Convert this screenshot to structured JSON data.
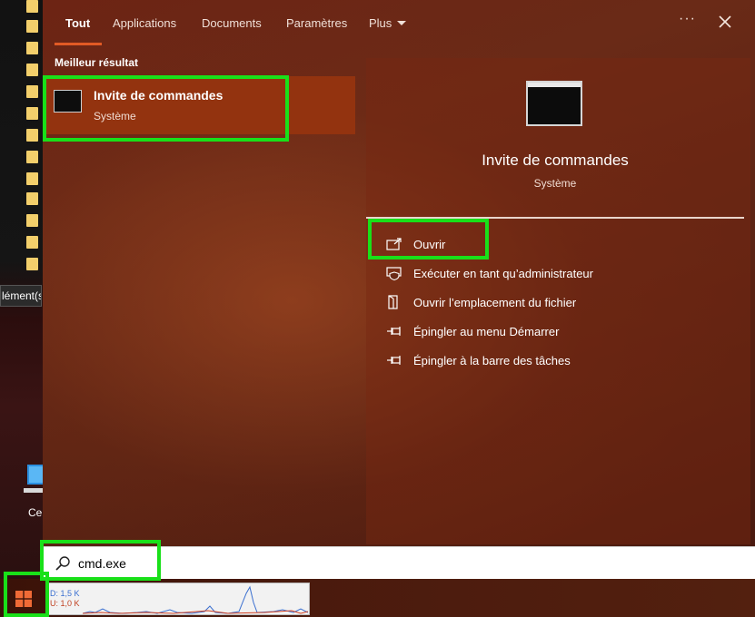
{
  "desktop": {
    "tooltip_fragment": "lément(s)",
    "icon_label_fragment": "Ce"
  },
  "tabs": [
    {
      "label": "Tout",
      "active": true
    },
    {
      "label": "Applications"
    },
    {
      "label": "Documents"
    },
    {
      "label": "Paramètres"
    },
    {
      "label": "Plus"
    }
  ],
  "header": {
    "more_icon": "···"
  },
  "best_match": {
    "heading": "Meilleur résultat",
    "title": "Invite de commandes",
    "subtitle": "Système"
  },
  "detail": {
    "title": "Invite de commandes",
    "subtitle": "Système",
    "actions": [
      {
        "label": "Ouvrir",
        "icon": "open-icon"
      },
      {
        "label": "Exécuter en tant qu’administrateur",
        "icon": "run-as-admin-icon"
      },
      {
        "label": "Ouvrir l’emplacement du fichier",
        "icon": "file-location-icon"
      },
      {
        "label": "Épingler au menu Démarrer",
        "icon": "pin-icon"
      },
      {
        "label": "Épingler à la barre des tâches",
        "icon": "pin-icon"
      }
    ]
  },
  "search": {
    "value": "cmd.exe"
  },
  "taskbar": {
    "net_down": "D: 1,5 K",
    "net_up": "U: 1,0 K"
  },
  "colors": {
    "accent": "#e25a25",
    "selected_result_bg": "#93330f",
    "highlight": "#19e019"
  }
}
